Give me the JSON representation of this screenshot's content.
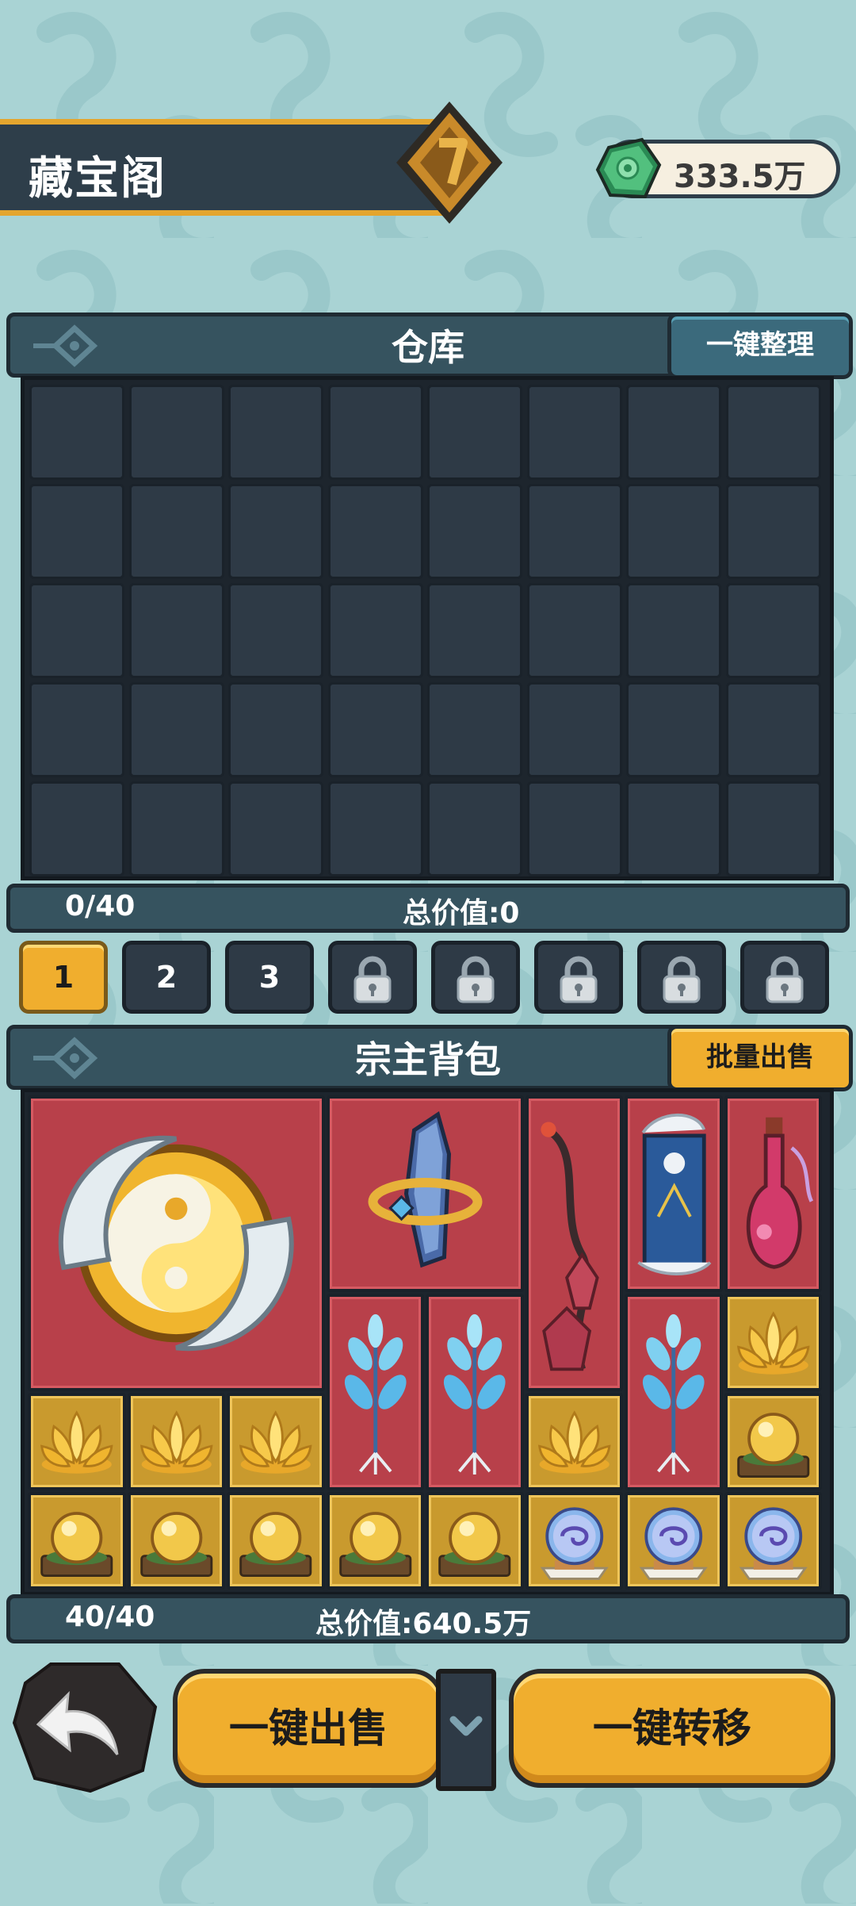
{
  "header": {
    "title": "藏宝阁",
    "currency": "333.5万"
  },
  "warehouse": {
    "title": "仓库",
    "organize_button": "一键整理",
    "capacity": "0/40",
    "total_value": "总价值:0",
    "rows": 5,
    "cols": 8
  },
  "pages": [
    {
      "label": "1",
      "state": "active"
    },
    {
      "label": "2",
      "state": "unlocked"
    },
    {
      "label": "3",
      "state": "unlocked"
    },
    {
      "label": "",
      "state": "locked",
      "icon": "lock-icon"
    },
    {
      "label": "",
      "state": "locked",
      "icon": "lock-icon"
    },
    {
      "label": "",
      "state": "locked",
      "icon": "lock-icon"
    },
    {
      "label": "",
      "state": "locked",
      "icon": "lock-icon"
    },
    {
      "label": "",
      "state": "locked",
      "icon": "lock-icon"
    }
  ],
  "bag": {
    "title": "宗主背包",
    "batch_sell_button": "批量出售",
    "capacity": "40/40",
    "total_value": "总价值:640.5万",
    "items": [
      {
        "icon": "yin-yang-orb-icon",
        "rarity": "red"
      },
      {
        "icon": "crystal-ring-icon",
        "rarity": "red"
      },
      {
        "icon": "flower-staff-icon",
        "rarity": "red"
      },
      {
        "icon": "banner-scroll-icon",
        "rarity": "red"
      },
      {
        "icon": "potion-flask-icon",
        "rarity": "red"
      },
      {
        "icon": "frost-herb-icon",
        "rarity": "red"
      },
      {
        "icon": "frost-herb-icon",
        "rarity": "red"
      },
      {
        "icon": "frost-herb-icon",
        "rarity": "red"
      },
      {
        "icon": "golden-lotus-icon",
        "rarity": "gold"
      },
      {
        "icon": "golden-lotus-icon",
        "rarity": "gold"
      },
      {
        "icon": "golden-lotus-icon",
        "rarity": "gold"
      },
      {
        "icon": "golden-lotus-icon",
        "rarity": "gold"
      },
      {
        "icon": "golden-lotus-icon",
        "rarity": "gold"
      },
      {
        "icon": "golden-pearl-icon",
        "rarity": "gold"
      },
      {
        "icon": "golden-pearl-icon",
        "rarity": "gold"
      },
      {
        "icon": "golden-pearl-icon",
        "rarity": "gold"
      },
      {
        "icon": "golden-pearl-icon",
        "rarity": "gold"
      },
      {
        "icon": "golden-pearl-icon",
        "rarity": "gold"
      },
      {
        "icon": "golden-pearl-icon",
        "rarity": "gold"
      },
      {
        "icon": "spirit-crystal-ball-icon",
        "rarity": "gold"
      },
      {
        "icon": "spirit-crystal-ball-icon",
        "rarity": "gold"
      },
      {
        "icon": "spirit-crystal-ball-icon",
        "rarity": "gold"
      }
    ]
  },
  "actions": {
    "sell_all": "一键出售",
    "transfer_all": "一键转移"
  },
  "colors": {
    "accent": "#f0ae2e",
    "panel": "#36535f",
    "background": "#a9d3d4",
    "rare_red": "#b8404a",
    "rare_gold": "#c99a2e"
  }
}
